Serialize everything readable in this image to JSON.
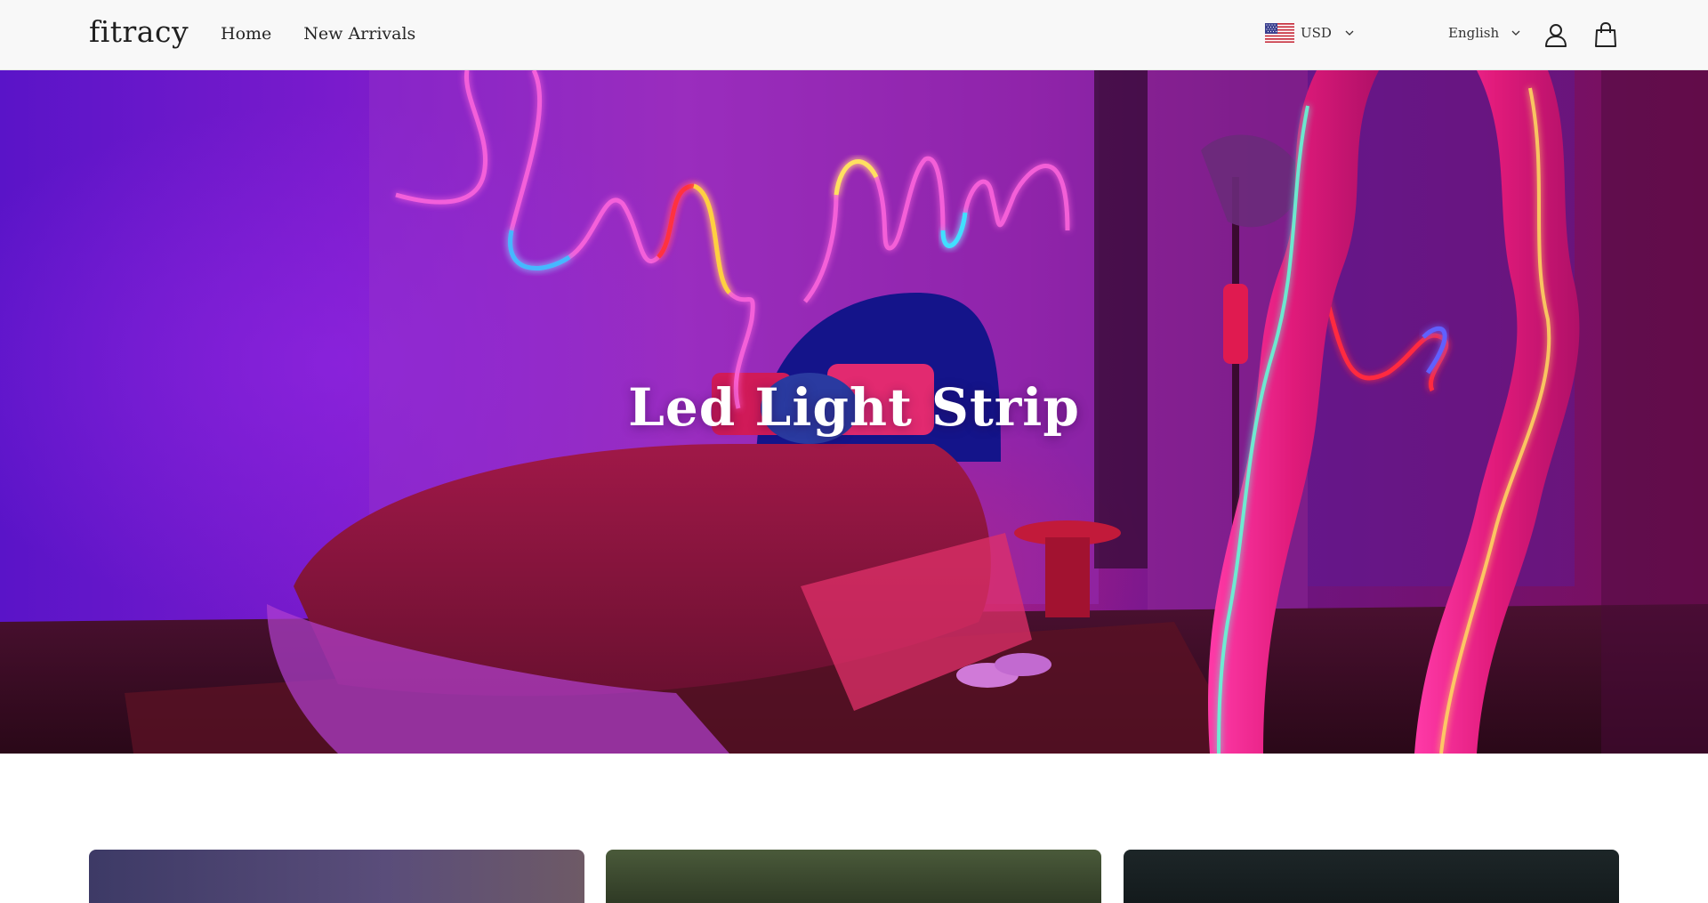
{
  "header": {
    "logo": "fitracy",
    "nav": [
      {
        "label": "Home"
      },
      {
        "label": "New Arrivals"
      }
    ],
    "currency": {
      "code": "USD",
      "flag_icon": "us-flag-icon"
    },
    "language": {
      "label": "English"
    },
    "account_icon": "user-icon",
    "cart_icon": "shopping-bag-icon"
  },
  "hero": {
    "title": "Led Light Strip"
  },
  "collections": [
    {
      "name": "collection-tile-1"
    },
    {
      "name": "collection-tile-2"
    },
    {
      "name": "collection-tile-3"
    }
  ],
  "colors": {
    "header_bg": "#f8f8f8",
    "text": "#1f1f1f",
    "hero_text": "#ffffff"
  }
}
